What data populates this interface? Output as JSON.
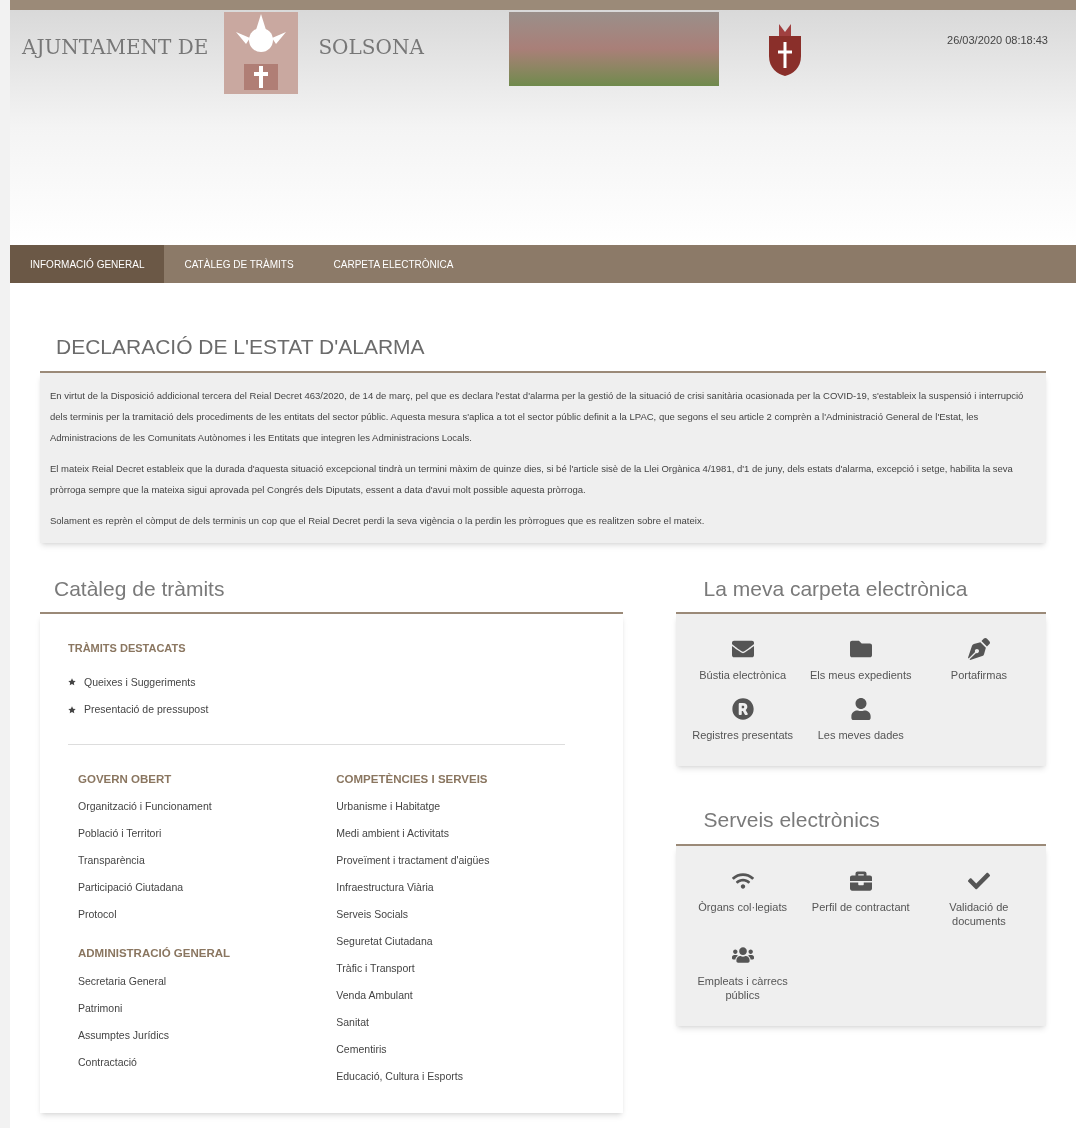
{
  "header": {
    "brand_left": "AJUNTAMENT DE",
    "brand_right": "SOLSONA",
    "datetime": "26/03/2020 08:18:43"
  },
  "tabs": [
    {
      "label": "INFORMACIÓ GENERAL",
      "selected": true
    },
    {
      "label": "CATÀLEG DE TRÀMITS",
      "selected": false
    },
    {
      "label": "CARPETA ELECTRÒNICA",
      "selected": false
    }
  ],
  "notice": {
    "title": "DECLARACIÓ DE L'ESTAT D'ALARMA",
    "paragraphs": [
      "En virtut de la Disposició addicional tercera del Reial Decret 463/2020, de 14 de març, pel que es declara l'estat d'alarma per la gestió de la situació de crisi sanitària ocasionada per la COVID-19, s'estableix la suspensió i interrupció dels terminis per la tramitació dels procediments de les entitats del sector públic. Aquesta mesura s'aplica a tot el sector públic definit a la LPAC, que segons el seu article 2 comprèn a l'Administració General de l'Estat, les Administracions de les Comunitats Autònomes i les Entitats que integren les Administracions Locals.",
      "El mateix Reial Decret estableix que la durada d'aquesta situació excepcional tindrà un termini màxim de quinze dies, si bé l'article sisè de la Llei Orgànica 4/1981, d'1 de juny, dels estats d'alarma, excepció i setge, habilita la seva pròrroga sempre que la mateixa sigui aprovada pel Congrés dels Diputats, essent a data d'avui molt possible aquesta pròrroga.",
      "Solament es reprèn el còmput de dels terminis un cop que el Reial Decret perdi la seva vigència o la perdin les pròrrogues que es realitzen sobre el mateix."
    ]
  },
  "catalog": {
    "title": "Catàleg de tràmits",
    "featured": {
      "heading": "TRÀMITS DESTACATS",
      "items": [
        "Queixes i Suggeriments",
        "Presentació de pressupost"
      ]
    },
    "columns": [
      [
        {
          "heading": "GOVERN OBERT",
          "items": [
            "Organització i Funcionament",
            "Població i Territori",
            "Transparència",
            "Participació Ciutadana",
            "Protocol"
          ]
        },
        {
          "heading": "ADMINISTRACIÓ GENERAL",
          "items": [
            "Secretaria General",
            "Patrimoni",
            "Assumptes Jurídics",
            "Contractació"
          ]
        }
      ],
      [
        {
          "heading": "COMPETÈNCIES I SERVEIS",
          "items": [
            "Urbanisme i Habitatge",
            "Medi ambient i Activitats",
            "Proveïment i tractament d'aigües",
            "Infraestructura Viària",
            "Serveis Socials",
            "Seguretat Ciutadana",
            "Tràfic i Transport",
            "Venda Ambulant",
            "Sanitat",
            "Cementiris",
            "Educació, Cultura i Esports"
          ]
        }
      ]
    ]
  },
  "carpeta": {
    "title": "La meva carpeta electrònica",
    "items": [
      "Bústia electrònica",
      "Els meus expedients",
      "Portafirmas",
      "Registres presentats",
      "Les meves dades"
    ]
  },
  "serveis": {
    "title": "Serveis electrònics",
    "items": [
      "Òrgans col·legiats",
      "Perfil de contractant",
      "Validació de documents",
      "Empleats i càrrecs públics"
    ]
  }
}
